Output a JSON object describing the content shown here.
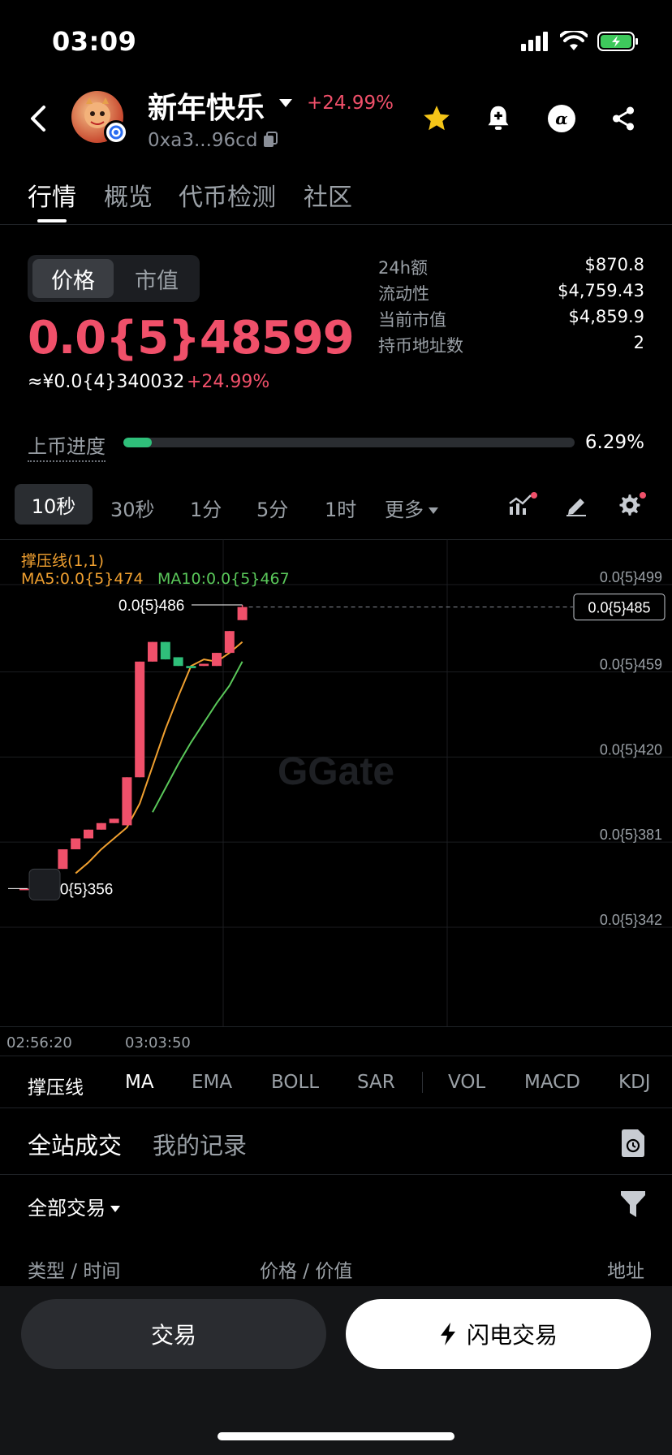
{
  "status": {
    "time": "03:09"
  },
  "token": {
    "name": "新年快乐",
    "change": "+24.99%",
    "address": "0xa3...96cd"
  },
  "tabs": [
    "行情",
    "概览",
    "代币检测",
    "社区"
  ],
  "price_toggle": {
    "active": "价格",
    "inactive": "市值"
  },
  "price": {
    "main": "0.0{5}48599",
    "cny": "≈¥0.0{4}340032",
    "change": "+24.99%"
  },
  "stats": [
    {
      "label": "24h额",
      "value": "$870.8"
    },
    {
      "label": "流动性",
      "value": "$4,759.43"
    },
    {
      "label": "当前市值",
      "value": "$4,859.9"
    },
    {
      "label": "持币地址数",
      "value": "2"
    }
  ],
  "listing_progress": {
    "label": "上币进度",
    "percent_text": "6.29%",
    "percent": 6.29
  },
  "intervals": [
    "10秒",
    "30秒",
    "1分",
    "5分",
    "1时",
    "更多"
  ],
  "chart_legend": {
    "indicator": "撑压线(1,1)",
    "ma5": "MA5:0.0{5}474",
    "ma10": "MA10:0.0{5}467"
  },
  "chart_data": {
    "type": "candlestick",
    "y_axis_ticks": [
      "0.0{5}499",
      "0.0{5}459",
      "0.0{5}420",
      "0.0{5}381",
      "0.0{5}342"
    ],
    "y_tick_values": [
      499,
      459,
      420,
      381,
      342
    ],
    "x_axis_ticks": [
      "02:56:20",
      "03:03:50"
    ],
    "current_price_label": "0.0{5}485",
    "high_label": "0.0{5}486",
    "low_label": "0.0{5}356",
    "candles": [
      {
        "o": 356,
        "c": 356,
        "h": 356,
        "l": 356
      },
      {
        "o": 352,
        "c": 360,
        "h": 360,
        "l": 352
      },
      {
        "o": 356,
        "c": 365,
        "h": 365,
        "l": 356
      },
      {
        "o": 365,
        "c": 374,
        "h": 374,
        "l": 365
      },
      {
        "o": 374,
        "c": 379,
        "h": 379,
        "l": 374
      },
      {
        "o": 379,
        "c": 383,
        "h": 383,
        "l": 379
      },
      {
        "o": 383,
        "c": 386,
        "h": 386,
        "l": 383
      },
      {
        "o": 386,
        "c": 388,
        "h": 388,
        "l": 386
      },
      {
        "o": 385,
        "c": 407,
        "h": 407,
        "l": 385
      },
      {
        "o": 407,
        "c": 460,
        "h": 460,
        "l": 407
      },
      {
        "o": 460,
        "c": 469,
        "h": 469,
        "l": 460
      },
      {
        "o": 469,
        "c": 461,
        "h": 469,
        "l": 461
      },
      {
        "o": 462,
        "c": 458,
        "h": 462,
        "l": 458
      },
      {
        "o": 458,
        "c": 457,
        "h": 458,
        "l": 457
      },
      {
        "o": 458,
        "c": 459,
        "h": 459,
        "l": 458
      },
      {
        "o": 458,
        "c": 464,
        "h": 464,
        "l": 458
      },
      {
        "o": 464,
        "c": 474,
        "h": 474,
        "l": 464
      },
      {
        "o": 479,
        "c": 485,
        "h": 486,
        "l": 479
      }
    ],
    "ma5": [
      null,
      null,
      null,
      null,
      363,
      368,
      374,
      379,
      384,
      395,
      412,
      429,
      444,
      458,
      461,
      460,
      464,
      469
    ],
    "ma10": [
      null,
      null,
      null,
      null,
      null,
      null,
      null,
      null,
      null,
      null,
      391,
      402,
      413,
      423,
      432,
      441,
      449,
      460
    ]
  },
  "indicators": [
    "撑压线",
    "MA",
    "EMA",
    "BOLL",
    "SAR",
    "VOL",
    "MACD",
    "KDJ"
  ],
  "trades": {
    "tabs": [
      "全站成交",
      "我的记录"
    ],
    "filter": "全部交易",
    "columns": [
      "类型 / 时间",
      "价格 / 价值",
      "地址"
    ]
  },
  "actions": {
    "trade": "交易",
    "flash": "闪电交易"
  },
  "colors": {
    "up": "#f0506a",
    "down": "#2fbf7a",
    "ma5": "#f0a030",
    "ma10": "#5ac85a"
  }
}
